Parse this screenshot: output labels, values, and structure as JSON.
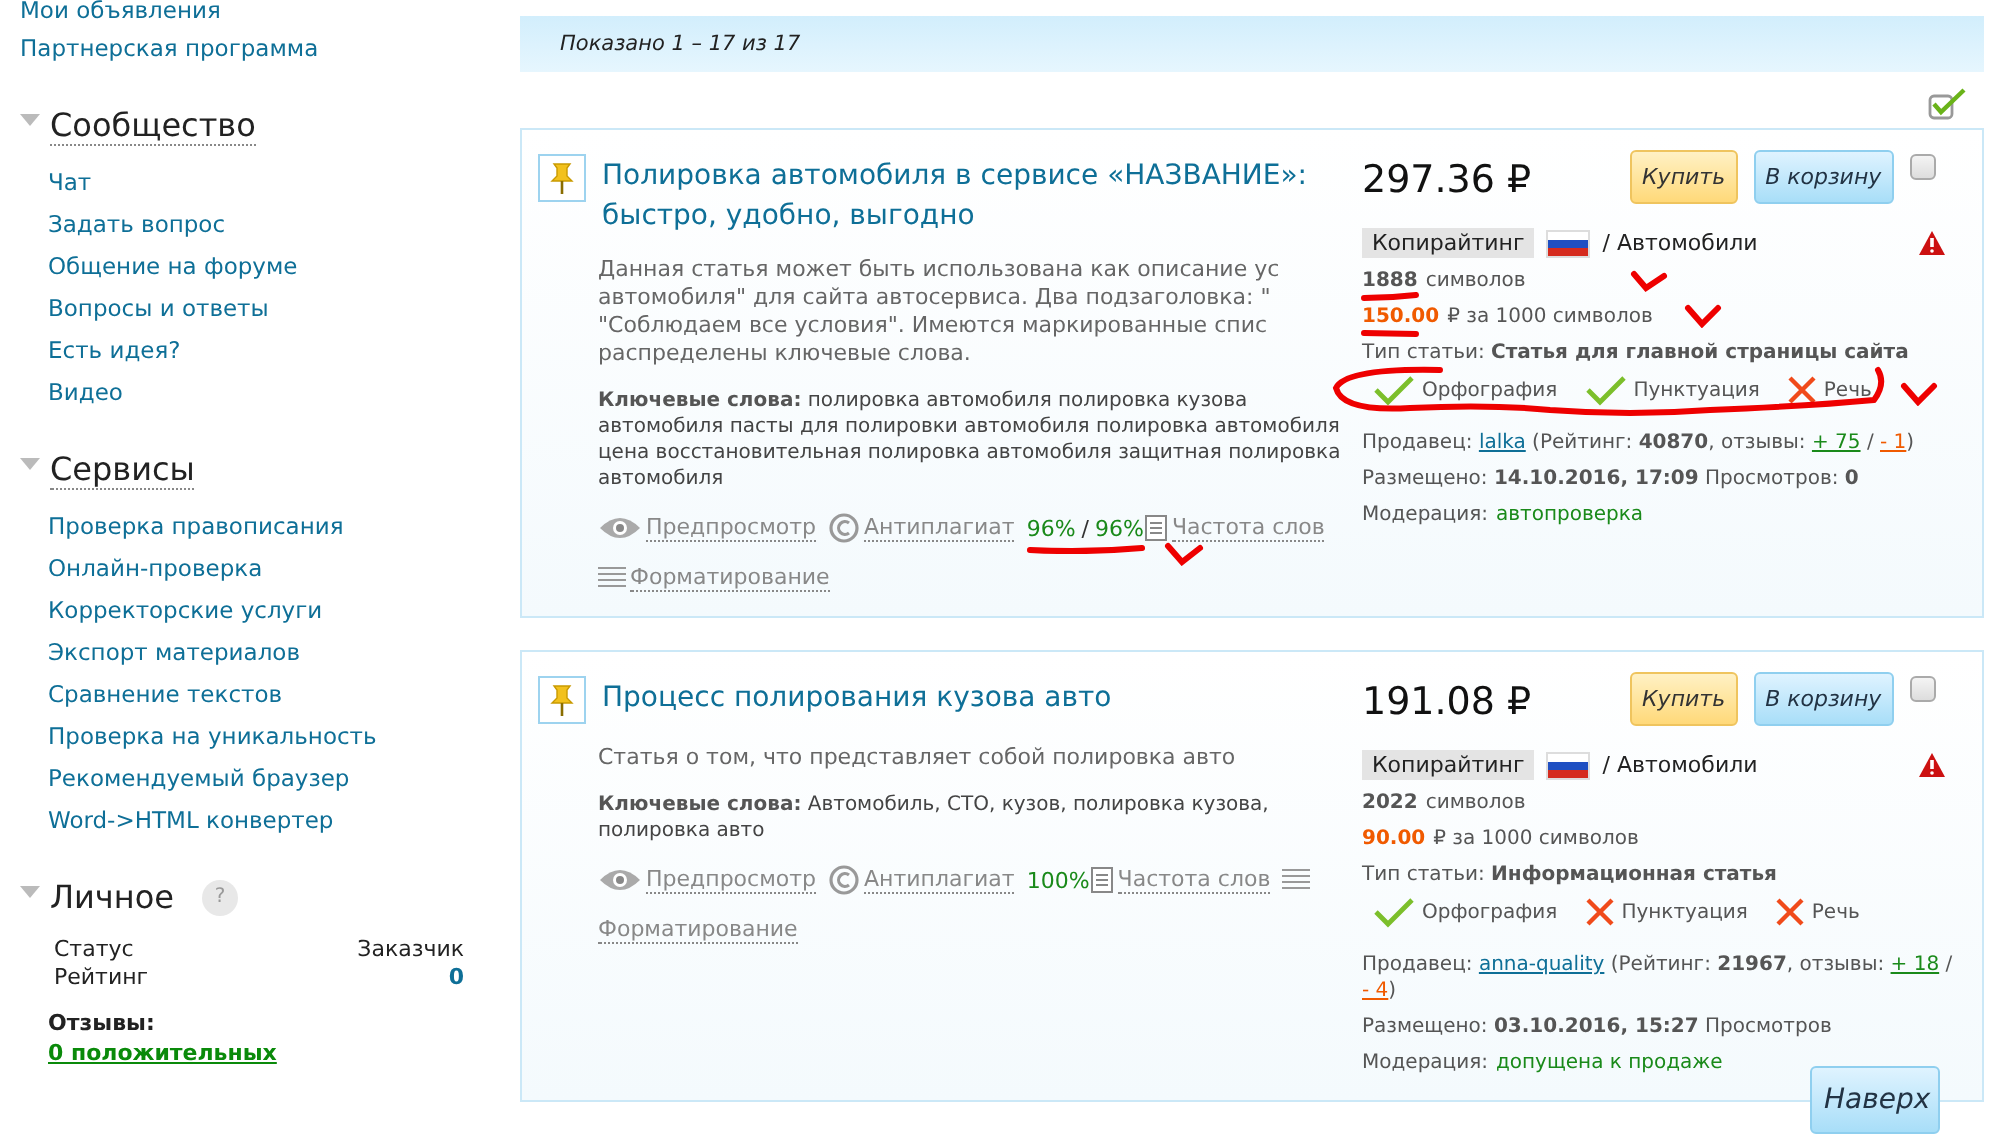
{
  "sidebar": {
    "top_links": [
      "Мои объявления",
      "Партнерская программа"
    ],
    "sections": [
      {
        "title": "Сообщество",
        "items": [
          "Чат",
          "Задать вопрос",
          "Общение на форуме",
          "Вопросы и ответы",
          "Есть идея?",
          "Видео"
        ]
      },
      {
        "title": "Сервисы",
        "items": [
          "Проверка правописания",
          "Онлайн-проверка",
          "Корректорские услуги",
          "Экспорт материалов",
          "Сравнение текстов",
          "Проверка на уникальность",
          "Рекомендуемый браузер",
          "Word->HTML конвертер"
        ]
      }
    ],
    "personal": {
      "title": "Личное",
      "help": "?",
      "rows": [
        {
          "label": "Статус",
          "value": "Заказчик",
          "kind": "plain"
        },
        {
          "label": "Рейтинг",
          "value": "0",
          "kind": "number"
        }
      ],
      "reviews_label": "Отзывы:",
      "reviews": "0 положительных"
    }
  },
  "results_bar": {
    "text": "Показано 1 – 17 из 17"
  },
  "select_all": {
    "checked": true
  },
  "articles": [
    {
      "title": "Полировка автомобиля в сервисе «НАЗВАНИЕ»: быстро, удобно, выгодно",
      "description": [
        "Данная статья может быть использована как описание ус",
        "автомобиля\" для сайта автосервиса. Два подзаголовка: \"",
        "\"Соблюдаем все условия\". Имеются маркированные спис",
        "распределены ключевые слова."
      ],
      "keywords_label": "Ключевые слова:",
      "keywords": "полировка автомобиля полировка кузова автомобиля пасты для полировки автомобиля полировка автомобиля цена восстановительная полировка автомобиля защитная полировка автомобиля",
      "preview": "Предпросмотр",
      "antiplagiat": "Антиплагиат",
      "uniqueness": [
        "96%",
        "96%"
      ],
      "uniqueness_sep": "/",
      "frequency": "Частота слов",
      "formatting": "Форматирование",
      "price": "297.36 ₽",
      "buy": "Купить",
      "cart": "В корзину",
      "selected": false,
      "category": "Копирайтинг",
      "subject": "/ Автомобили",
      "chars": "1888",
      "chars_label": "символов",
      "price_per": "150.00",
      "price_per_label": "₽ за 1000 символов",
      "type": "Тип статьи: **Статья для главной страницы сайта**",
      "checks": [
        {
          "label": "Орфография",
          "passed": true
        },
        {
          "label": "Пунктуация",
          "passed": true
        },
        {
          "label": "Речь",
          "passed": false
        }
      ],
      "seller_label": "Продавец:",
      "seller": "lalka",
      "rating": "(Рейтинг: **40870**, отзывы:",
      "plus": "+ 75",
      "slash": "/",
      "minus": "- 1",
      "close": ")",
      "posted": "Размещено: **14.10.2016, 17:09** Просмотров: **0**",
      "moderation_label": "Модерация:",
      "moderation": "автопроверка"
    },
    {
      "title": "Процесс полирования кузова авто",
      "description": [
        "Статья о том, что представляет собой полировка авто"
      ],
      "keywords_label": "Ключевые слова:",
      "keywords": "Автомобиль, СТО, кузов, полировка кузова, полировка авто",
      "preview": "Предпросмотр",
      "antiplagiat": "Антиплагиат",
      "uniqueness": [
        "100%"
      ],
      "frequency": "Частота слов",
      "formatting": "Форматирование",
      "price": "191.08 ₽",
      "buy": "Купить",
      "cart": "В корзину",
      "selected": false,
      "category": "Копирайтинг",
      "subject": "/ Автомобили",
      "chars": "2022",
      "chars_label": "символов",
      "price_per": "90.00",
      "price_per_label": "₽ за 1000 символов",
      "type": "Тип статьи: **Информационная статья**",
      "checks": [
        {
          "label": "Орфография",
          "passed": true
        },
        {
          "label": "Пунктуация",
          "passed": false
        },
        {
          "label": "Речь",
          "passed": false
        }
      ],
      "seller_label": "Продавец:",
      "seller": "anna-quality",
      "rating": "(Рейтинг: **21967**, отзывы:",
      "plus": "+ 18",
      "slash": "/",
      "minus": "- 4",
      "close": ")",
      "posted": "Размещено: **03.10.2016, 15:27** Просмотров",
      "moderation_label": "Модерация:",
      "moderation": "допущена к продаже"
    }
  ],
  "back_to_top": "Наверх"
}
